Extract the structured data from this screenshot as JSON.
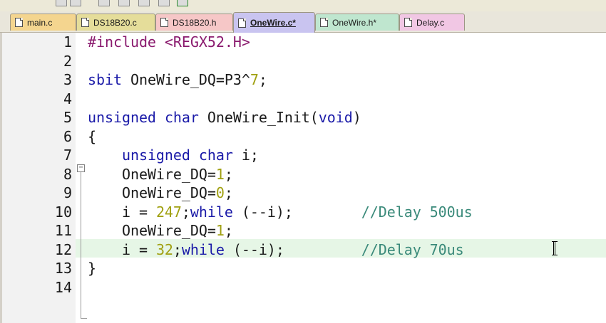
{
  "tabs": [
    {
      "label": "main.c",
      "color": "#f4d58f",
      "active": false
    },
    {
      "label": "DS18B20.c",
      "color": "#e5dd9a",
      "active": false
    },
    {
      "label": "DS18B20.h",
      "color": "#f6c7c7",
      "active": false
    },
    {
      "label": "OneWire.c*",
      "color": "#c9c4f0",
      "active": true
    },
    {
      "label": "OneWire.h*",
      "color": "#bfe6cf",
      "active": false
    },
    {
      "label": "Delay.c",
      "color": "#f1c7e4",
      "active": false
    }
  ],
  "editor": {
    "current_line": 12,
    "line_numbers": [
      "1",
      "2",
      "3",
      "4",
      "5",
      "6",
      "7",
      "8",
      "9",
      "10",
      "11",
      "12",
      "13",
      "14"
    ],
    "lines": [
      [
        {
          "t": "#include <REGX52.H>",
          "c": "pp"
        }
      ],
      [],
      [
        {
          "t": "sbit",
          "c": "kw"
        },
        {
          "t": " OneWire_DQ=P3^"
        },
        {
          "t": "7",
          "c": "num"
        },
        {
          "t": ";"
        }
      ],
      [],
      [
        {
          "t": "unsigned",
          "c": "kw"
        },
        {
          "t": " "
        },
        {
          "t": "char",
          "c": "kw"
        },
        {
          "t": " OneWire_Init("
        },
        {
          "t": "void",
          "c": "kw"
        },
        {
          "t": ")"
        }
      ],
      [
        {
          "t": "{"
        }
      ],
      [
        {
          "t": "    "
        },
        {
          "t": "unsigned",
          "c": "kw"
        },
        {
          "t": " "
        },
        {
          "t": "char",
          "c": "kw"
        },
        {
          "t": " i;"
        }
      ],
      [
        {
          "t": "    OneWire_DQ="
        },
        {
          "t": "1",
          "c": "num"
        },
        {
          "t": ";"
        }
      ],
      [
        {
          "t": "    OneWire_DQ="
        },
        {
          "t": "0",
          "c": "num"
        },
        {
          "t": ";"
        }
      ],
      [
        {
          "t": "    i = "
        },
        {
          "t": "247",
          "c": "num"
        },
        {
          "t": ";"
        },
        {
          "t": "while",
          "c": "kw"
        },
        {
          "t": " (--i);        "
        },
        {
          "t": "//Delay 500us",
          "c": "cm"
        }
      ],
      [
        {
          "t": "    OneWire_DQ="
        },
        {
          "t": "1",
          "c": "num"
        },
        {
          "t": ";"
        }
      ],
      [
        {
          "t": "    i = "
        },
        {
          "t": "32",
          "c": "num"
        },
        {
          "t": ";"
        },
        {
          "t": "while",
          "c": "kw"
        },
        {
          "t": " (--i);         "
        },
        {
          "t": "//Delay 70us",
          "c": "cm"
        }
      ],
      [
        {
          "t": "}"
        }
      ],
      []
    ]
  }
}
